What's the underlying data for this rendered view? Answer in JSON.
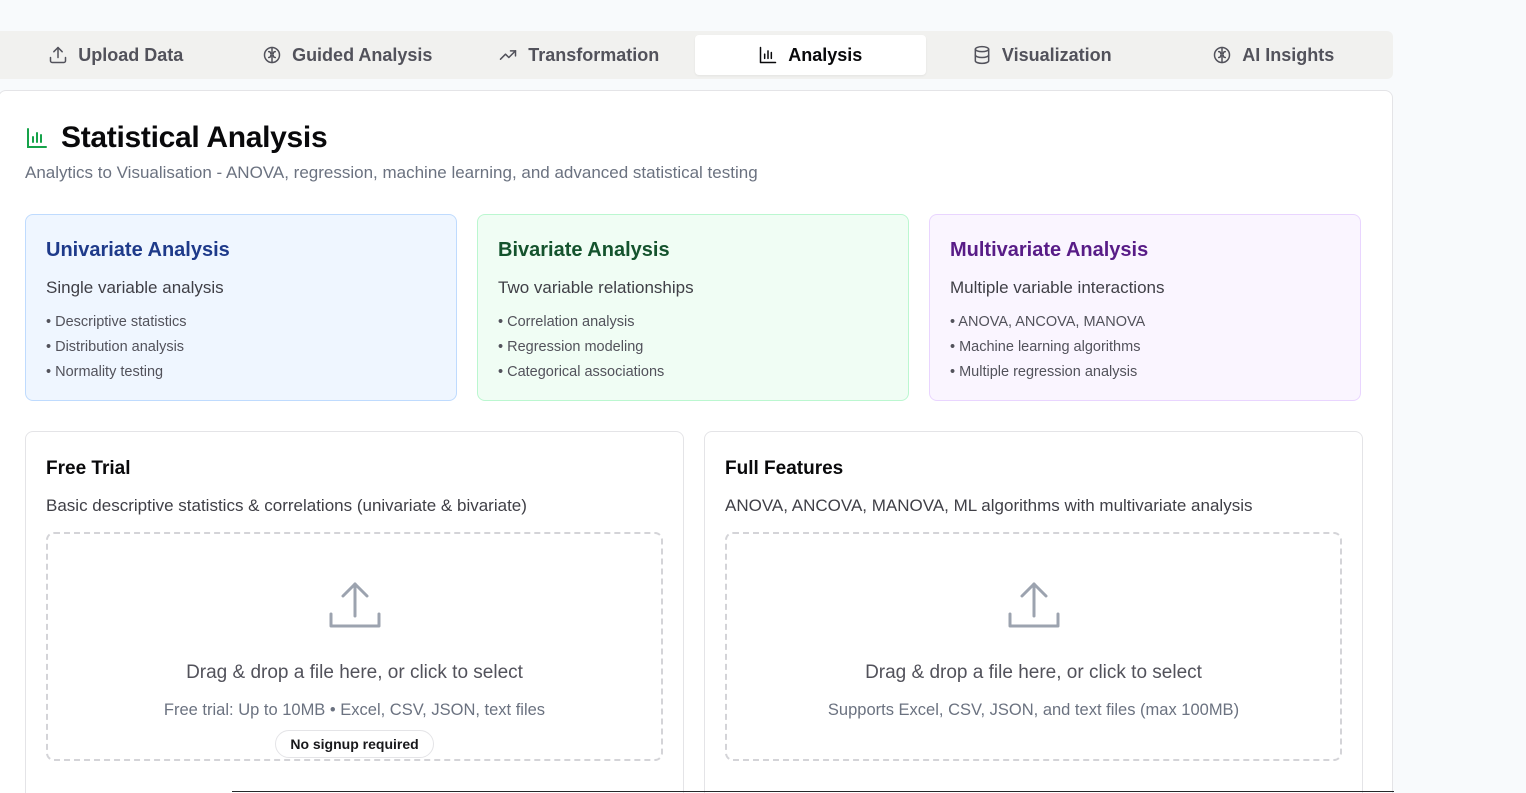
{
  "tabs": [
    {
      "label": "Upload Data",
      "icon": "upload-icon"
    },
    {
      "label": "Guided Analysis",
      "icon": "brain-icon"
    },
    {
      "label": "Transformation",
      "icon": "trending-up-icon"
    },
    {
      "label": "Analysis",
      "icon": "bar-chart-icon",
      "active": true
    },
    {
      "label": "Visualization",
      "icon": "database-icon"
    },
    {
      "label": "AI Insights",
      "icon": "brain-icon"
    }
  ],
  "header": {
    "title": "Statistical Analysis",
    "subtitle": "Analytics to Visualisation - ANOVA, regression, machine learning, and advanced statistical testing",
    "icon": "bar-chart-icon",
    "icon_color": "#16a34a"
  },
  "cards": [
    {
      "title": "Univariate Analysis",
      "desc": "Single variable analysis",
      "items": [
        "• Descriptive statistics",
        "• Distribution analysis",
        "• Normality testing"
      ],
      "accent": "#1e3a8a"
    },
    {
      "title": "Bivariate Analysis",
      "desc": "Two variable relationships",
      "items": [
        "• Correlation analysis",
        "• Regression modeling",
        "• Categorical associations"
      ],
      "accent": "#14532d"
    },
    {
      "title": "Multivariate Analysis",
      "desc": "Multiple variable interactions",
      "items": [
        "• ANOVA, ANCOVA, MANOVA",
        "• Machine learning algorithms",
        "• Multiple regression analysis"
      ],
      "accent": "#581c87"
    }
  ],
  "plans": [
    {
      "title": "Free Trial",
      "desc": "Basic descriptive statistics & correlations (univariate & bivariate)",
      "drop_main": "Drag & drop a file here, or click to select",
      "drop_sub": "Free trial: Up to 10MB • Excel, CSV, JSON, text files",
      "badge": "No signup required"
    },
    {
      "title": "Full Features",
      "desc": "ANOVA, ANCOVA, MANOVA, ML algorithms with multivariate analysis",
      "drop_main": "Drag & drop a file here, or click to select",
      "drop_sub": "Supports Excel, CSV, JSON, and text files (max 100MB)"
    }
  ]
}
